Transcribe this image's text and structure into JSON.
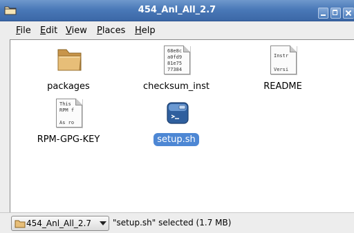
{
  "window": {
    "title": "454_Anl_All_2.7"
  },
  "menubar": {
    "items": [
      {
        "mnemonic": "F",
        "rest": "ile"
      },
      {
        "mnemonic": "E",
        "rest": "dit"
      },
      {
        "mnemonic": "V",
        "rest": "iew"
      },
      {
        "mnemonic": "P",
        "rest": "laces"
      },
      {
        "mnemonic": "H",
        "rest": "elp"
      }
    ]
  },
  "files": [
    {
      "name": "packages",
      "icon": "folder-icon"
    },
    {
      "name": "checksum_inst",
      "icon": "text-file-icon",
      "preview": [
        "68e8c",
        "a0fd9",
        "81e75",
        "77384"
      ]
    },
    {
      "name": "README",
      "icon": "text-file-icon",
      "preview": [
        "Instr",
        "",
        "",
        "Versi"
      ]
    },
    {
      "name": "RPM-GPG-KEY",
      "icon": "text-file-icon",
      "preview": [
        "This",
        "RPM f",
        "",
        "As ro"
      ]
    },
    {
      "name": "setup.sh",
      "icon": "shell-script-icon",
      "selected": true
    }
  ],
  "statusbar": {
    "location": "454_Anl_All_2.7",
    "status": "\"setup.sh\" selected (1.7 MB)"
  },
  "colors": {
    "titlebar": "#4a79b8",
    "selection": "#4d87d4",
    "folder": "#e0b56b"
  }
}
